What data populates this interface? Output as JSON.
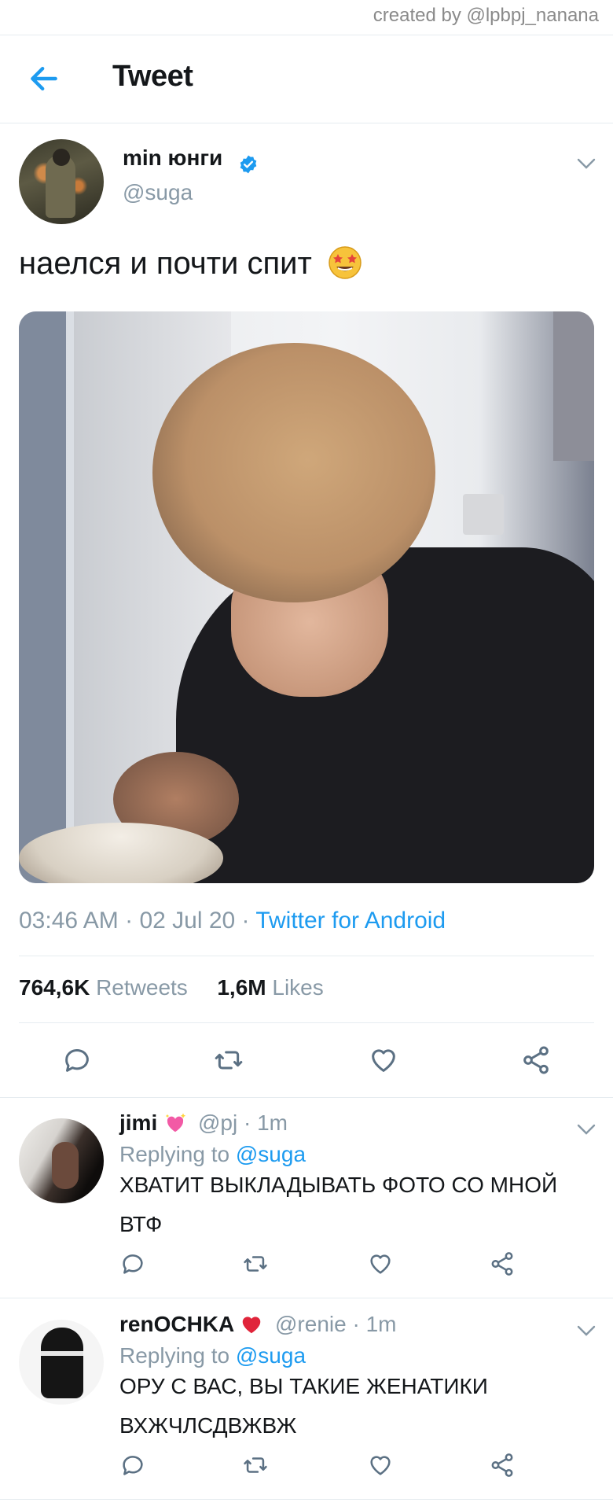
{
  "watermark": "created by @lpbpj_nanana",
  "header": {
    "title": "Tweet",
    "back_icon": "arrow-left-icon"
  },
  "tweet": {
    "author_name": "min юнги",
    "verified": true,
    "author_handle": "@suga",
    "text": "наелся и почти спит",
    "emoji": "star-struck-emoji",
    "time": "03:46 AM",
    "sep1": " · ",
    "date": "02 Jul 20",
    "sep2": " · ",
    "source": "Twitter for Android",
    "retweets_count": "764,6K",
    "retweets_label": "Retweets",
    "likes_count": "1,6M",
    "likes_label": "Likes"
  },
  "replies": [
    {
      "name": "jimi",
      "emoji": "sparkling-heart-emoji",
      "handle": "@pj",
      "time": "· 1m",
      "replying_prefix": "Replying to",
      "replying_to": "@suga",
      "text": "ХВАТИТ ВЫКЛАДЫВАТЬ ФОТО СО МНОЙ ВТФ"
    },
    {
      "name": "renOCHKA",
      "emoji": "red-heart-emoji",
      "handle": "@renie",
      "time": "· 1m",
      "replying_prefix": "Replying to",
      "replying_to": "@suga",
      "text": "ОРУ С ВАС, ВЫ ТАКИЕ ЖЕНАТИКИ ВХЖЧЛСДВЖВЖ"
    }
  ],
  "colors": {
    "accent": "#1d9bf0",
    "secondary_text": "#8899a6",
    "divider": "#e6ecf0",
    "icon": "#5b7083"
  }
}
